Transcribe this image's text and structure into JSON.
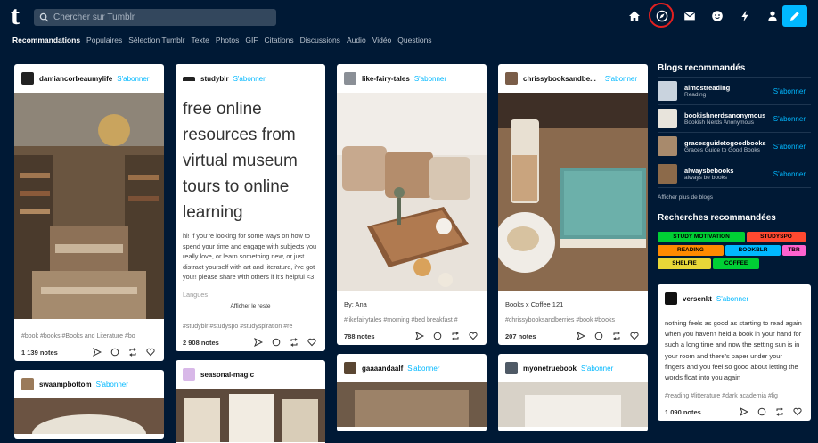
{
  "header": {
    "logo": "t",
    "search_placeholder": "Chercher sur Tumblr",
    "icons": [
      "home-icon",
      "explore-icon",
      "mail-icon",
      "messaging-icon",
      "activity-icon",
      "account-icon",
      "compose-icon"
    ]
  },
  "tabs": [
    "Recommandations",
    "Populaires",
    "Sélection Tumblr",
    "Texte",
    "Photos",
    "GIF",
    "Citations",
    "Discussions",
    "Audio",
    "Vidéo",
    "Questions"
  ],
  "follow_label": "S'abonner",
  "posts": {
    "p1": {
      "user": "damiancorbeaumylife",
      "tags": "#book   #books   #Books and Literature   #bo",
      "notes": "1 139 notes"
    },
    "p2": {
      "user": "studyblr",
      "title": "free online resources from virtual museum tours to online learning",
      "body": "hi! if you're looking for some ways on how to spend your time and engage with subjects you really love, or learn something new, or just distract yourself with art and literature, i've got you!! please share with others if it's helpful <3",
      "cut": "Langues",
      "readmore": "Afficher le reste",
      "tags": "#studyblr   #studyspo   #studyspiration   #re",
      "notes": "2 908 notes"
    },
    "p3": {
      "user": "like-fairy-tales",
      "caption": "By: Ana",
      "tags": "#likefairytales   #morning   #bed breakfast   #",
      "notes": "788 notes"
    },
    "p4": {
      "user": "chrissybooksandbe...",
      "caption": "Books x Coffee 121",
      "tags": "#chrissybooksandberries   #book   #books",
      "notes": "207 notes"
    },
    "p5": {
      "user": "swaampbottom"
    },
    "p6": {
      "user": "seasonal-magic"
    },
    "p7": {
      "user": "gaaaandaalf"
    },
    "p8": {
      "user": "myonetruebook"
    }
  },
  "sidebar": {
    "blogs_title": "Blogs recommandés",
    "blogs": [
      {
        "name": "almostreading",
        "sub": "Reading"
      },
      {
        "name": "bookishnerdsanonymous",
        "sub": "Bookish Nerds Anonymous"
      },
      {
        "name": "gracesguidetogoodbooks",
        "sub": "Graces Guide to Good Books"
      },
      {
        "name": "alwaysbebooks",
        "sub": "always be books"
      }
    ],
    "more_blogs": "Afficher plus de blogs",
    "searches_title": "Recherches recommandées",
    "searches": [
      {
        "label": "STUDY MOTIVATION",
        "color": "#00cf35"
      },
      {
        "label": "STUDYSPO",
        "color": "#ff4930"
      },
      {
        "label": "READING",
        "color": "#ff8a00"
      },
      {
        "label": "BOOKBLR",
        "color": "#00b8ff"
      },
      {
        "label": "TBR",
        "color": "#ff62ce"
      },
      {
        "label": "SHELFIE",
        "color": "#e8d738"
      },
      {
        "label": "COFFEE",
        "color": "#00cf35"
      }
    ],
    "card": {
      "user": "versenkt",
      "body": "nothing feels as good as starting to read again when you haven't held a book in your hand for such a long time and now the setting sun is in your room and there's paper under your fingers and you feel so good about letting the words float into you again",
      "tags": "#reading   #litterature   #dark academia   #lig",
      "notes": "1 090 notes"
    }
  },
  "colors": {
    "background": "#001935",
    "accent": "#00b8ff",
    "highlight_circle": "#e32020"
  }
}
